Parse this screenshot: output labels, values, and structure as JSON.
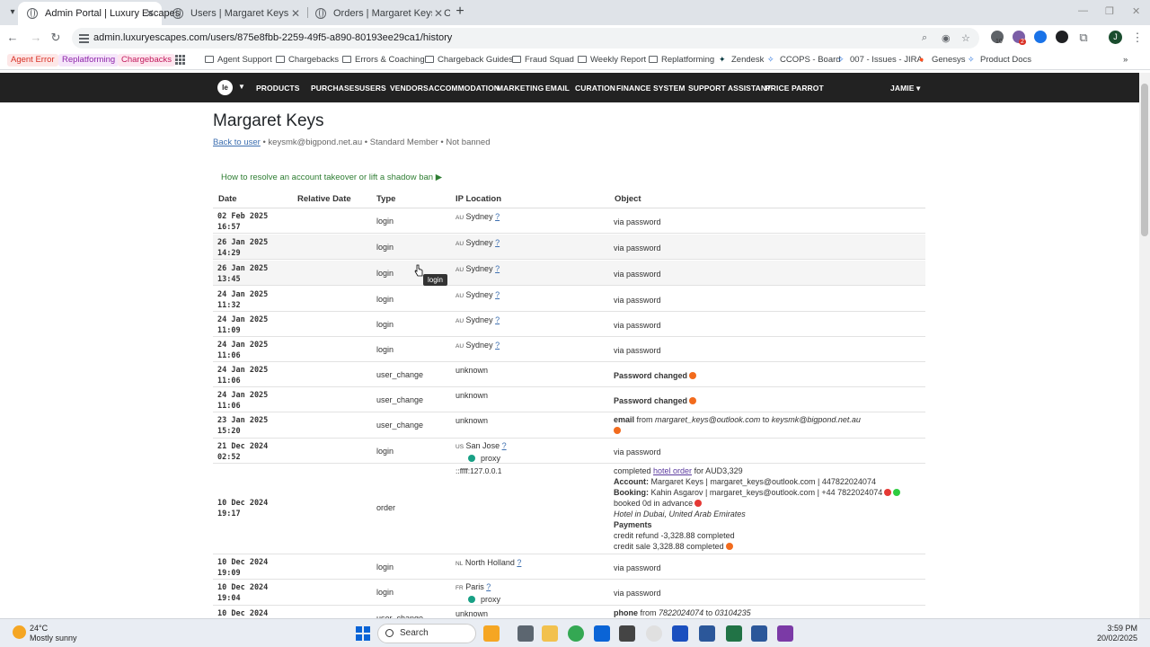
{
  "browser": {
    "tabs": [
      {
        "title": "Admin Portal | Luxury Escapes",
        "active": true
      },
      {
        "title": "Users | Margaret Keys",
        "active": false
      },
      {
        "title": "Orders | Margaret Keys | Order",
        "active": false
      }
    ],
    "url": "admin.luxuryescapes.com/users/875e8fbb-2259-49f5-a890-80193ee29ca1/history",
    "ext_badge_1": "10",
    "ext_badge_2": "2",
    "profile_initial": "J",
    "bookmarks": {
      "pills": [
        {
          "label": "Agent Error",
          "color": "#d93025",
          "bg": "#fde7e7"
        },
        {
          "label": "Replatforming",
          "color": "#8e24aa",
          "bg": "#f6e6fa"
        },
        {
          "label": "Chargebacks",
          "color": "#c2185b",
          "bg": "#fde6ef"
        }
      ],
      "folders": [
        "Agent Support",
        "Chargebacks",
        "Errors & Coaching",
        "Chargeback Guides",
        "Fraud Squad",
        "Weekly Report",
        "Replatforming"
      ],
      "links": [
        "Zendesk",
        "CCOPS - Board",
        "007 - Issues - JIRA",
        "Genesys",
        "Product Docs"
      ]
    }
  },
  "appnav": {
    "items": [
      "PRODUCTS",
      "PURCHASES",
      "USERS",
      "VENDORS",
      "ACCOMMODATION",
      "MARKETING",
      "EMAIL",
      "CURATION",
      "FINANCE",
      "SYSTEM",
      "SUPPORT ASSISTANT",
      "PRICE PARROT"
    ],
    "user": "JAMIE",
    "logo": "le"
  },
  "page": {
    "title": "Margaret Keys",
    "back_link": "Back to user",
    "meta": " • keysmk@bigpond.net.au • Standard Member • Not banned",
    "help_link": "How to resolve an account takeover or lift a shadow ban ▶",
    "columns": [
      "Date",
      "Relative Date",
      "Type",
      "IP Location",
      "Object"
    ]
  },
  "rows": [
    {
      "date": "02 Feb 2025",
      "time": "16:57",
      "type": "login",
      "cc": "AU",
      "loc": "Sydney",
      "q": "?",
      "obj": "via password"
    },
    {
      "date": "26 Jan 2025",
      "time": "14:29",
      "type": "login",
      "cc": "AU",
      "loc": "Sydney",
      "q": "?",
      "obj": "via password"
    },
    {
      "date": "26 Jan 2025",
      "time": "13:45",
      "type": "login",
      "cc": "AU",
      "loc": "Sydney",
      "q": "?",
      "obj": "via password"
    },
    {
      "date": "24 Jan 2025",
      "time": "11:32",
      "type": "login",
      "cc": "AU",
      "loc": "Sydney",
      "q": "?",
      "obj": "via password"
    },
    {
      "date": "24 Jan 2025",
      "time": "11:09",
      "type": "login",
      "cc": "AU",
      "loc": "Sydney",
      "q": "?",
      "obj": "via password"
    },
    {
      "date": "24 Jan 2025",
      "time": "11:06",
      "type": "login",
      "cc": "AU",
      "loc": "Sydney",
      "q": "?",
      "obj": "via password"
    },
    {
      "date": "24 Jan 2025",
      "time": "11:06",
      "type": "user_change",
      "loc": "unknown",
      "obj_bold": "Password changed"
    },
    {
      "date": "24 Jan 2025",
      "time": "11:06",
      "type": "user_change",
      "loc": "unknown",
      "obj_bold": "Password changed"
    },
    {
      "date": "23 Jan 2025",
      "time": "15:20",
      "type": "user_change",
      "loc": "unknown",
      "email_label": "email",
      "from_word": " from ",
      "from": "margaret_keys@outlook.com",
      "to_word": " to ",
      "to": "keysmk@bigpond.net.au"
    },
    {
      "date": "21 Dec 2024",
      "time": "02:52",
      "type": "login",
      "cc": "US",
      "loc": "San Jose",
      "q": "?",
      "proxy": "proxy",
      "obj": "via password"
    },
    {
      "date": "10 Dec 2024",
      "time": "19:17",
      "type": "order",
      "loc": "::ffff:127.0.0.1",
      "order": {
        "completed": "completed ",
        "hotel_order": "hotel order",
        "for": " for AUD3,329",
        "account_label": "Account:",
        "account": " Margaret Keys | margaret_keys@outlook.com | 447822024074",
        "booking_label": "Booking:",
        "booking": " Kahin Asgarov | margaret_keys@outlook.com | +44 7822024074",
        "advance": "booked 0d in advance",
        "hotel": "Hotel in Dubai, United Arab Emirates",
        "payments": "Payments",
        "refund": "credit refund -3,328.88 completed",
        "sale": "credit sale 3,328.88 completed"
      }
    },
    {
      "date": "10 Dec 2024",
      "time": "19:09",
      "type": "login",
      "cc": "NL",
      "loc": "North Holland",
      "q": "?",
      "obj": "via password"
    },
    {
      "date": "10 Dec 2024",
      "time": "19:04",
      "type": "login",
      "cc": "FR",
      "loc": "Paris",
      "q": "?",
      "proxy": "proxy",
      "obj": "via password"
    },
    {
      "date": "10 Dec 2024",
      "time": "",
      "type": "user_change",
      "loc": "unknown",
      "phone_label": "phone",
      "from_word": " from ",
      "from": "7822024074",
      "to_word": " to ",
      "to": "03104235"
    }
  ],
  "tooltip": "login",
  "taskbar": {
    "temp": "24°C",
    "weather": "Mostly sunny",
    "search": "Search",
    "time": "3:59 PM",
    "date": "20/02/2025"
  },
  "colors": {
    "nav_bg": "#222222",
    "help_green": "#2e7d32",
    "status_orange": "#f26b1d",
    "status_red": "#e53935",
    "status_green": "#2ecc40",
    "proxy_teal": "#18a085"
  }
}
